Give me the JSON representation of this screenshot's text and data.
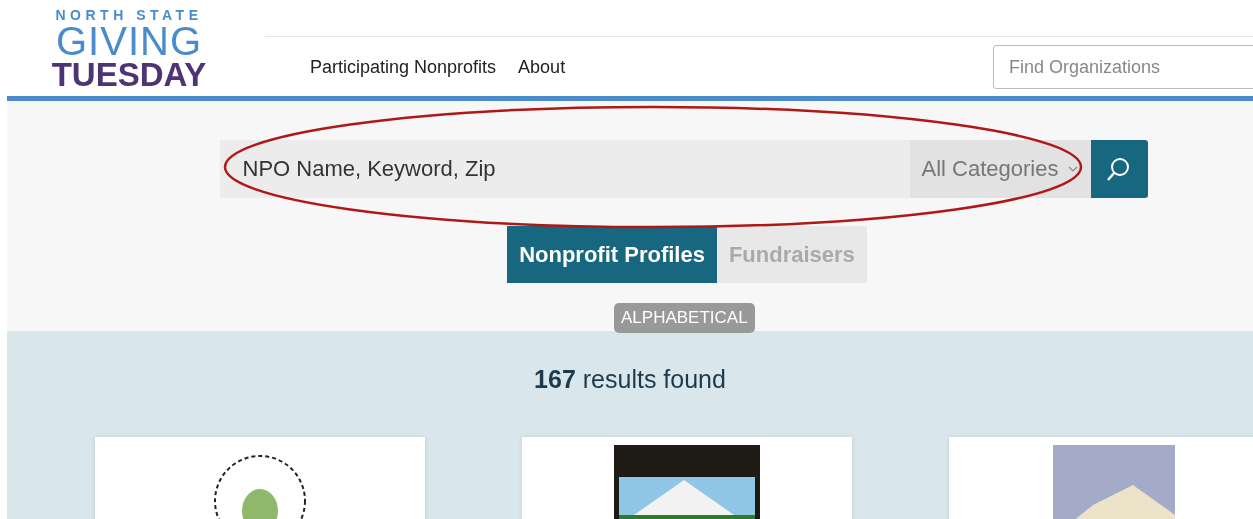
{
  "logo": {
    "line_1": "NORTH STATE",
    "line_2": "GIVING",
    "line_3": "TUESDAY"
  },
  "nav": [
    {
      "label": "Participating Nonprofits"
    },
    {
      "label": "About"
    }
  ],
  "header_search": {
    "placeholder": "Find Organizations"
  },
  "search": {
    "placeholder": "NPO Name, Keyword, Zip",
    "category": "All Categories"
  },
  "tabs": [
    {
      "label": "Nonprofit Profiles",
      "selected": true
    },
    {
      "label": "Fundraisers",
      "selected": false
    }
  ],
  "sort_badge": "ALPHABETICAL",
  "results": {
    "count": "167",
    "text": "results found"
  },
  "cards": [
    {
      "kind": "round"
    },
    {
      "kind": "tall"
    },
    {
      "kind": "mountain"
    }
  ]
}
